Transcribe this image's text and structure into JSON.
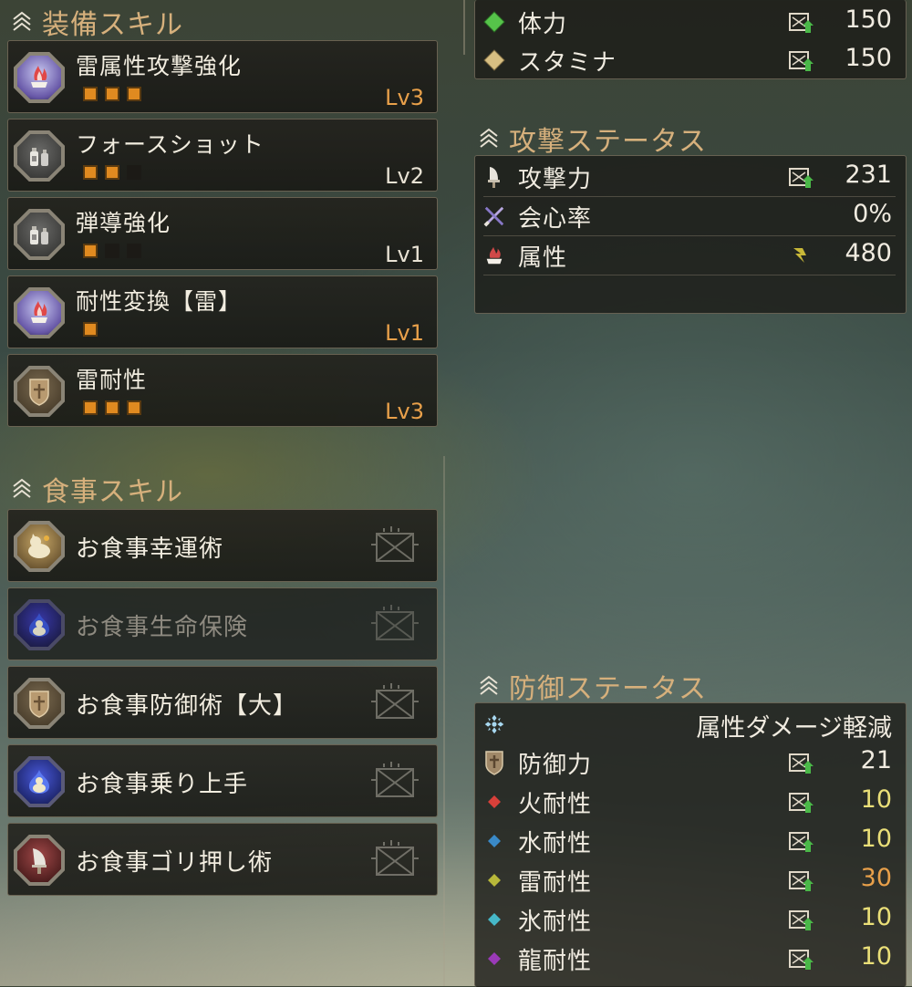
{
  "equip": {
    "title": "装備スキル",
    "skills": [
      {
        "name": "雷属性攻撃強化",
        "level": "Lv3",
        "filled": 3,
        "max": 3,
        "icon": "thunder-attack-icon"
      },
      {
        "name": "フォースショット",
        "level": "Lv2",
        "filled": 2,
        "max": 3,
        "icon": "bottle-icon"
      },
      {
        "name": "弾導強化",
        "level": "Lv1",
        "filled": 1,
        "max": 3,
        "icon": "bottle-icon"
      },
      {
        "name": "耐性変換【雷】",
        "level": "Lv1",
        "filled": 1,
        "max": 1,
        "icon": "thunder-attack-icon"
      },
      {
        "name": "雷耐性",
        "level": "Lv3",
        "filled": 3,
        "max": 3,
        "icon": "shield-icon"
      }
    ]
  },
  "food": {
    "title": "食事スキル",
    "skills": [
      {
        "name": "お食事幸運術",
        "active": true,
        "icon": "lucky-cat-icon"
      },
      {
        "name": "お食事生命保険",
        "active": false,
        "icon": "lucky-cat-icon"
      },
      {
        "name": "お食事防御術【大】",
        "active": true,
        "icon": "shield-icon"
      },
      {
        "name": "お食事乗り上手",
        "active": true,
        "icon": "lucky-cat-icon"
      },
      {
        "name": "お食事ゴリ押し術",
        "active": true,
        "icon": "sword-icon"
      }
    ]
  },
  "base": {
    "health_label": "体力",
    "health_value": "150",
    "stamina_label": "スタミナ",
    "stamina_value": "150"
  },
  "attack": {
    "title": "攻撃ステータス",
    "attack_label": "攻撃力",
    "attack_value": "231",
    "affinity_label": "会心率",
    "affinity_value": "0%",
    "element_label": "属性",
    "element_value": "480"
  },
  "defense": {
    "title": "防御ステータス",
    "elemental_reduction": "属性ダメージ軽減",
    "defense_label": "防御力",
    "defense_value": "21",
    "fire_label": "火耐性",
    "fire_value": "10",
    "water_label": "水耐性",
    "water_value": "10",
    "thunder_label": "雷耐性",
    "thunder_value": "30",
    "ice_label": "氷耐性",
    "ice_value": "10",
    "dragon_label": "龍耐性",
    "dragon_value": "10"
  },
  "colors": {
    "accent_title": "#d6b07c",
    "pip_on": "#e08a20",
    "level_orange": "#e8a04a",
    "resist_yellow": "#eadf78",
    "health": "#56c44a",
    "stamina": "#d8bf82",
    "fire": "#d8403a",
    "water": "#3a8ac8",
    "thunder": "#b8b83a",
    "ice": "#46b8c8",
    "dragon": "#9a3ab8"
  }
}
